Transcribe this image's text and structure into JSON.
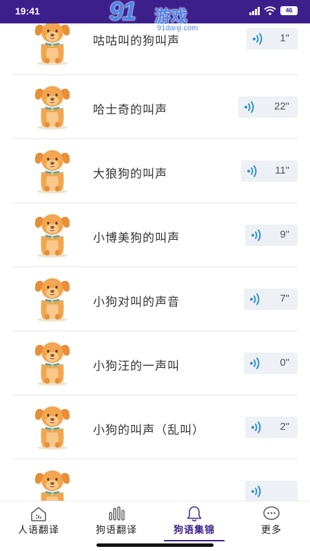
{
  "status_bar": {
    "time": "19:41",
    "battery": "46",
    "icons": [
      "signal-icon",
      "wifi-icon",
      "battery-icon"
    ],
    "background": "#3d1f8c"
  },
  "watermark": {
    "brand": "91",
    "name": "游戏",
    "url": "91danji.com",
    "color": "#4d86e8"
  },
  "list": {
    "items": [
      {
        "title": "咕咕叫的狗叫声",
        "duration": "1\""
      },
      {
        "title": "哈士奇的叫声",
        "duration": "22\""
      },
      {
        "title": "大狼狗的叫声",
        "duration": "11\""
      },
      {
        "title": "小博美狗的叫声",
        "duration": "9\""
      },
      {
        "title": "小狗对叫的声音",
        "duration": "7\""
      },
      {
        "title": "小狗汪的一声叫",
        "duration": "0\""
      },
      {
        "title": "小狗的叫声（乱叫）",
        "duration": "2\""
      },
      {
        "title": "",
        "duration": ""
      }
    ]
  },
  "tab_bar": {
    "active_color": "#3d1f8c",
    "tabs": [
      {
        "label": "人语翻译",
        "icon": "home-icon"
      },
      {
        "label": "狗语翻译",
        "icon": "equalizer-icon"
      },
      {
        "label": "狗语集锦",
        "icon": "bell-icon",
        "active": true
      },
      {
        "label": "更多",
        "icon": "more-icon"
      }
    ]
  }
}
